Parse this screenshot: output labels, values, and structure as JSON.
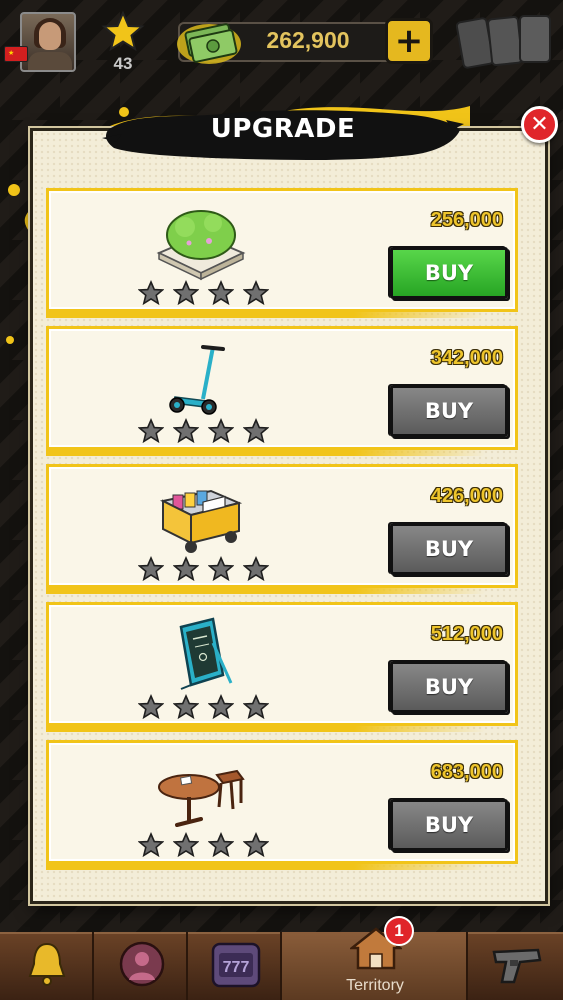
{
  "hud": {
    "level": "43",
    "cash": "262,900",
    "plus_label": "+"
  },
  "modal": {
    "title": "UPGRADE",
    "close_label": "✕"
  },
  "items": [
    {
      "name": "bush-planter",
      "price": "256,000",
      "buy_label": "BUY",
      "state": "active",
      "stars_filled": 0,
      "stars_total": 4
    },
    {
      "name": "kick-scooter",
      "price": "342,000",
      "buy_label": "BUY",
      "state": "disabled",
      "stars_filled": 0,
      "stars_total": 4
    },
    {
      "name": "food-cart",
      "price": "426,000",
      "buy_label": "BUY",
      "state": "disabled",
      "stars_filled": 0,
      "stars_total": 4
    },
    {
      "name": "menu-sign",
      "price": "512,000",
      "buy_label": "BUY",
      "state": "disabled",
      "stars_filled": 0,
      "stars_total": 4
    },
    {
      "name": "table-and-stool",
      "price": "683,000",
      "buy_label": "BUY",
      "state": "disabled",
      "stars_filled": 0,
      "stars_total": 4
    }
  ],
  "nav": {
    "tabs": [
      {
        "icon": "bell-icon"
      },
      {
        "icon": "character-icon"
      },
      {
        "icon": "slot-machine-icon",
        "label_icon_text": "777"
      },
      {
        "icon": "territory-house-icon",
        "label": "Territory",
        "badge": "1"
      },
      {
        "icon": "pistol-icon"
      }
    ]
  },
  "colors": {
    "accent_yellow": "#f1c419",
    "buy_active": "#3fc236",
    "buy_disabled": "#6e6e6e",
    "price_gold": "#eec52c",
    "close_red": "#e0252a"
  }
}
